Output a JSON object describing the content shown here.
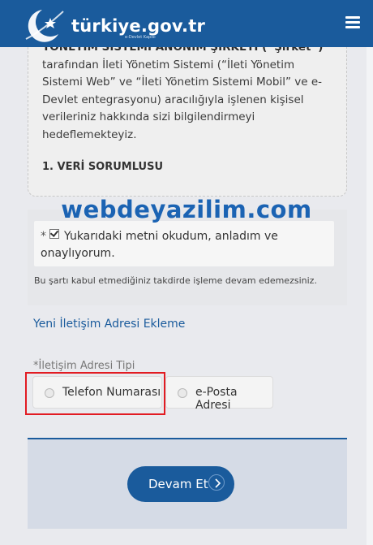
{
  "header": {
    "logo_text": "türkiye.gov.tr",
    "logo_subtext": "e-Devlet Kapısı"
  },
  "kvkk": {
    "company_line": "YÖNETİM SİSTEMİ ANONİM ŞİRKETİ (“Şirket”)",
    "body": "tarafından İleti Yönetim Sistemi (“İleti Yönetim Sistemi Web” ve “İleti Yönetim Sistemi Mobil” ve e-Devlet entegrasyonu) aracılığıyla işlenen kişisel verileriniz hakkında sizi bilgilendirmeyi hedeflemekteyiz.",
    "section_title": "1. VERİ SORUMLUSU"
  },
  "watermark": "webdeyazilim.com",
  "consent": {
    "required_mark": "*",
    "label": "Yukarıdaki metni okudum, anladım ve onaylıyorum.",
    "warning": "Bu şartı kabul etmediğiniz takdirde işleme devam edemezsiniz."
  },
  "new_address_link": "Yeni İletişim Adresi Ekleme",
  "address_type": {
    "label": "*İletişim Adresi Tipi",
    "options": [
      "Telefon Numarası",
      "e-Posta Adresi"
    ]
  },
  "continue_button": "Devam Et",
  "colors": {
    "header": "#1a5b9c",
    "highlight_frame": "#e21b22",
    "watermark": "#1b63b3"
  }
}
